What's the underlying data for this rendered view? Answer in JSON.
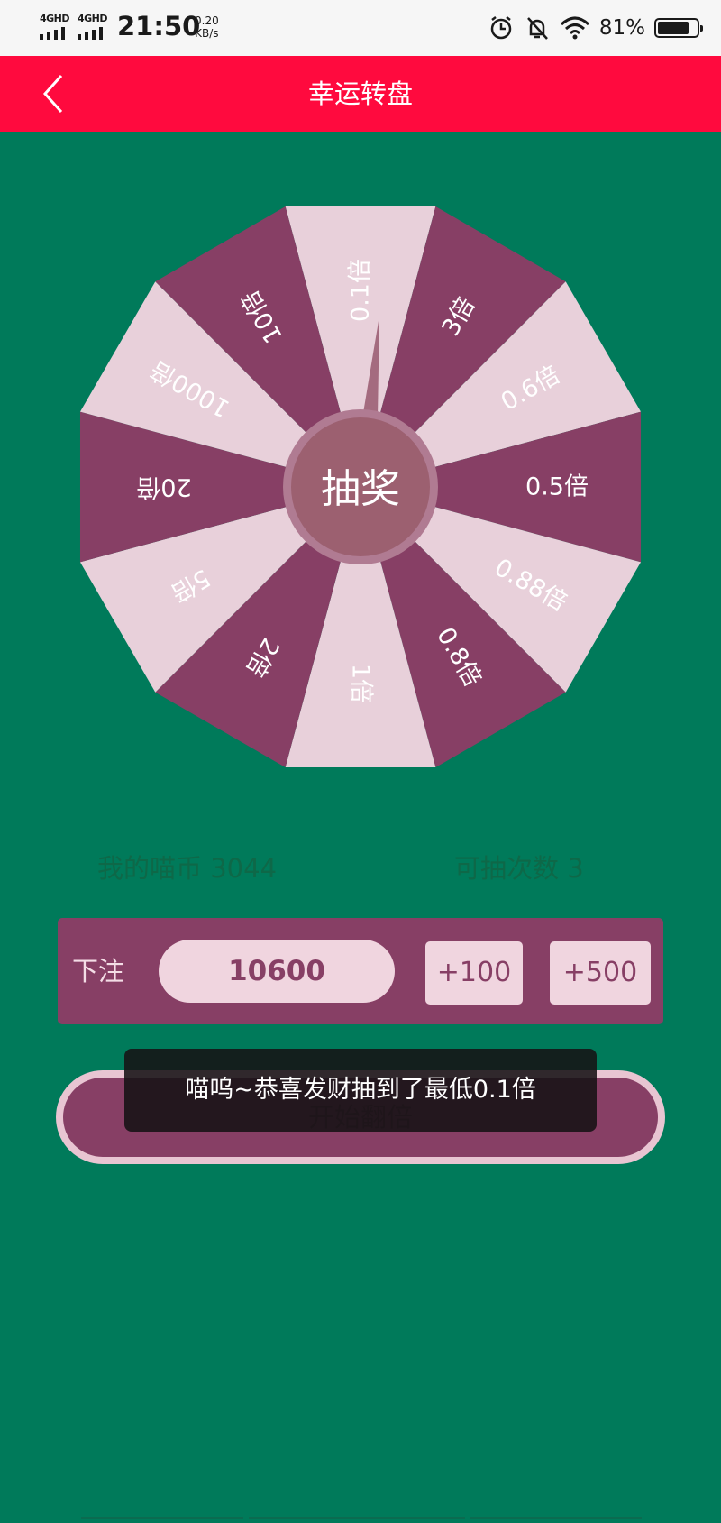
{
  "status": {
    "sim1": "4GHD",
    "sim2": "4GHD",
    "time": "21:50",
    "speed_value": "0.20",
    "speed_unit": "KB/s",
    "battery": "81%",
    "battery_level": 0.81
  },
  "nav": {
    "title": "幸运转盘"
  },
  "wheel": {
    "center_label": "抽奖",
    "segments": [
      "0.1倍",
      "3倍",
      "0.6倍",
      "0.5倍",
      "0.88倍",
      "0.8倍",
      "1倍",
      "2倍",
      "5倍",
      "20倍",
      "1000倍",
      "10倍"
    ],
    "colors": {
      "light": "#e8d0da",
      "dark": "#873f65",
      "hub": "#9c6070",
      "hub_ring": "#b07b92"
    }
  },
  "stats": {
    "coins": "我的喵币  3044",
    "draws": "可抽次数  3"
  },
  "bet": {
    "label": "下注",
    "amount": "10600",
    "add100": "+100",
    "add500": "+500"
  },
  "start_label": "开始翻倍",
  "toast": "喵呜~恭喜发财抽到了最低0.1倍",
  "colors": {
    "background": "#007a5a",
    "header": "#ff0a3e",
    "panel": "#873f65"
  }
}
